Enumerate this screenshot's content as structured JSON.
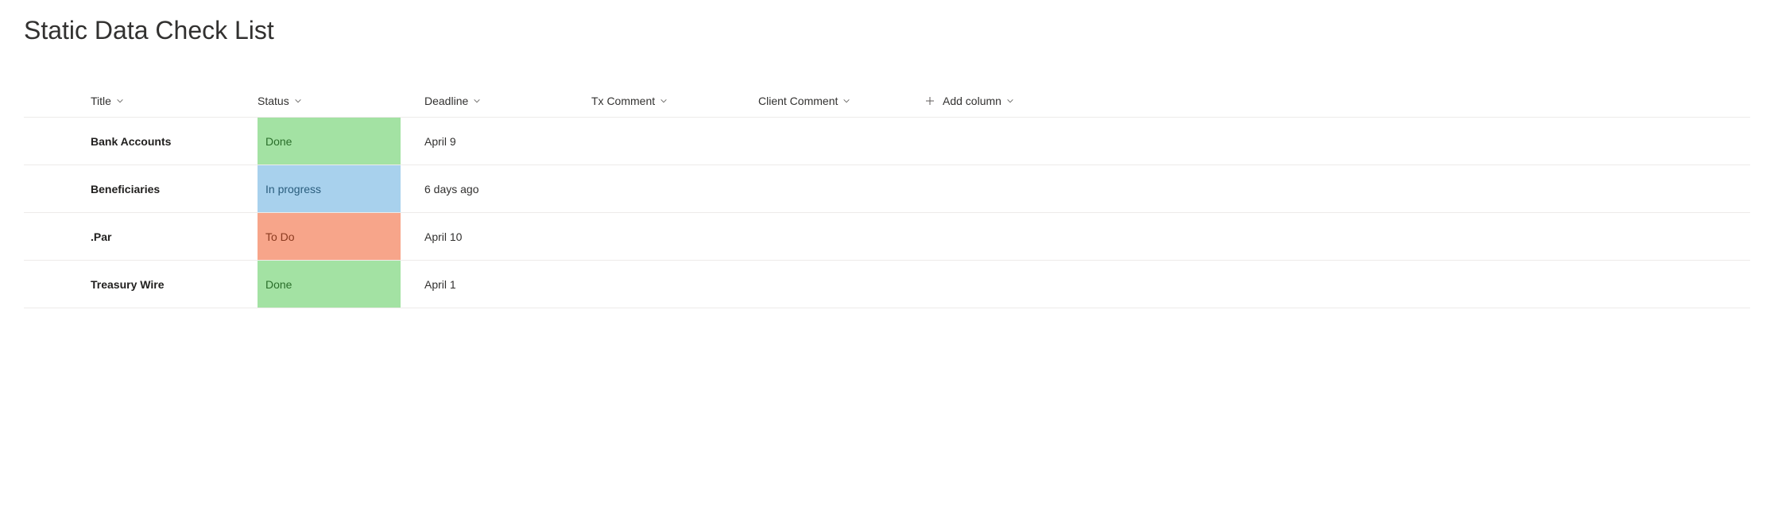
{
  "title": "Static Data Check List",
  "columns": {
    "title": "Title",
    "status": "Status",
    "deadline": "Deadline",
    "tx_comment": "Tx Comment",
    "client_comment": "Client Comment",
    "add_column": "Add column"
  },
  "status_styles": {
    "Done": "status-done",
    "In progress": "status-progress",
    "To Do": "status-todo"
  },
  "rows": [
    {
      "title": "Bank Accounts",
      "status": "Done",
      "deadline": "April 9",
      "tx_comment": "",
      "client_comment": ""
    },
    {
      "title": "Beneficiaries",
      "status": "In progress",
      "deadline": "6 days ago",
      "tx_comment": "",
      "client_comment": ""
    },
    {
      "title": ".Par",
      "status": "To Do",
      "deadline": "April 10",
      "tx_comment": "",
      "client_comment": ""
    },
    {
      "title": "Treasury Wire",
      "status": "Done",
      "deadline": "April 1",
      "tx_comment": "",
      "client_comment": ""
    }
  ]
}
